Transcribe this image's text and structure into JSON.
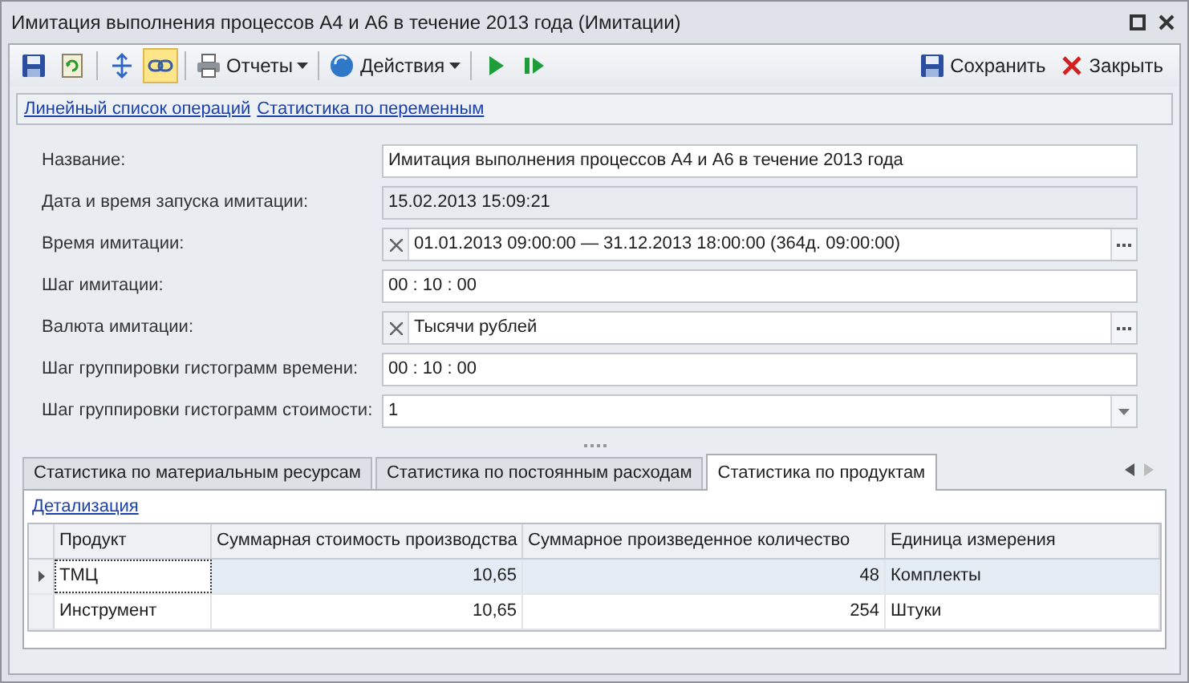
{
  "window": {
    "title": "Имитация выполнения процессов А4 и А6 в течение 2013 года (Имитации)"
  },
  "toolbar": {
    "left": [
      {
        "kind": "save",
        "selected": false
      },
      {
        "kind": "refresh",
        "selected": false
      },
      {
        "kind": "separator"
      },
      {
        "kind": "expand",
        "selected": false
      },
      {
        "kind": "link",
        "selected": true
      },
      {
        "kind": "separator"
      },
      {
        "kind": "printer_menu",
        "label": "Отчеты"
      },
      {
        "kind": "separator"
      },
      {
        "kind": "globe_menu",
        "label": "Действия"
      },
      {
        "kind": "separator"
      },
      {
        "kind": "play",
        "selected": false
      },
      {
        "kind": "step",
        "selected": false
      }
    ],
    "right": [
      {
        "kind": "save",
        "label": "Сохранить"
      },
      {
        "kind": "close",
        "label": "Закрыть"
      }
    ]
  },
  "links": [
    "Линейный список операций",
    "Статистика по переменным"
  ],
  "fields": [
    {
      "label": "Название:",
      "kind": "text",
      "value": "Имитация выполнения процессов А4 и А6 в течение 2013 года"
    },
    {
      "label": "Дата и время запуска имитации:",
      "kind": "readonly",
      "value": "15.02.2013 15:09:21"
    },
    {
      "label": "Время имитации:",
      "kind": "clear_ellipsis",
      "value": "01.01.2013 09:00:00 — 31.12.2013 18:00:00 (364д. 09:00:00)"
    },
    {
      "label": "Шаг имитации:",
      "kind": "text",
      "value": "00 : 10 : 00"
    },
    {
      "label": "Валюта имитации:",
      "kind": "clear_ellipsis",
      "value": "Тысячи рублей"
    },
    {
      "label": "Шаг группировки гистограмм времени:",
      "kind": "text",
      "value": "00 : 10 : 00"
    },
    {
      "label": "Шаг группировки гистограмм стоимости:",
      "kind": "dropdown",
      "value": "1"
    }
  ],
  "tabs": [
    {
      "label": "Статистика по материальным ресурсам",
      "selected": false
    },
    {
      "label": "Статистика по постоянным расходам",
      "selected": false
    },
    {
      "label": "Статистика по продуктам",
      "selected": true
    }
  ],
  "detail_link": "Детализация",
  "table": {
    "columns": [
      "Продукт",
      "Суммарная стоимость производства",
      "Суммарное произведенное количество",
      "Единица измерения"
    ],
    "rows": [
      {
        "cells": [
          "ТМЦ",
          "10,65",
          "48",
          "Комплекты"
        ],
        "selected": true
      },
      {
        "cells": [
          "Инструмент",
          "10,65",
          "254",
          "Штуки"
        ],
        "selected": false
      }
    ]
  }
}
